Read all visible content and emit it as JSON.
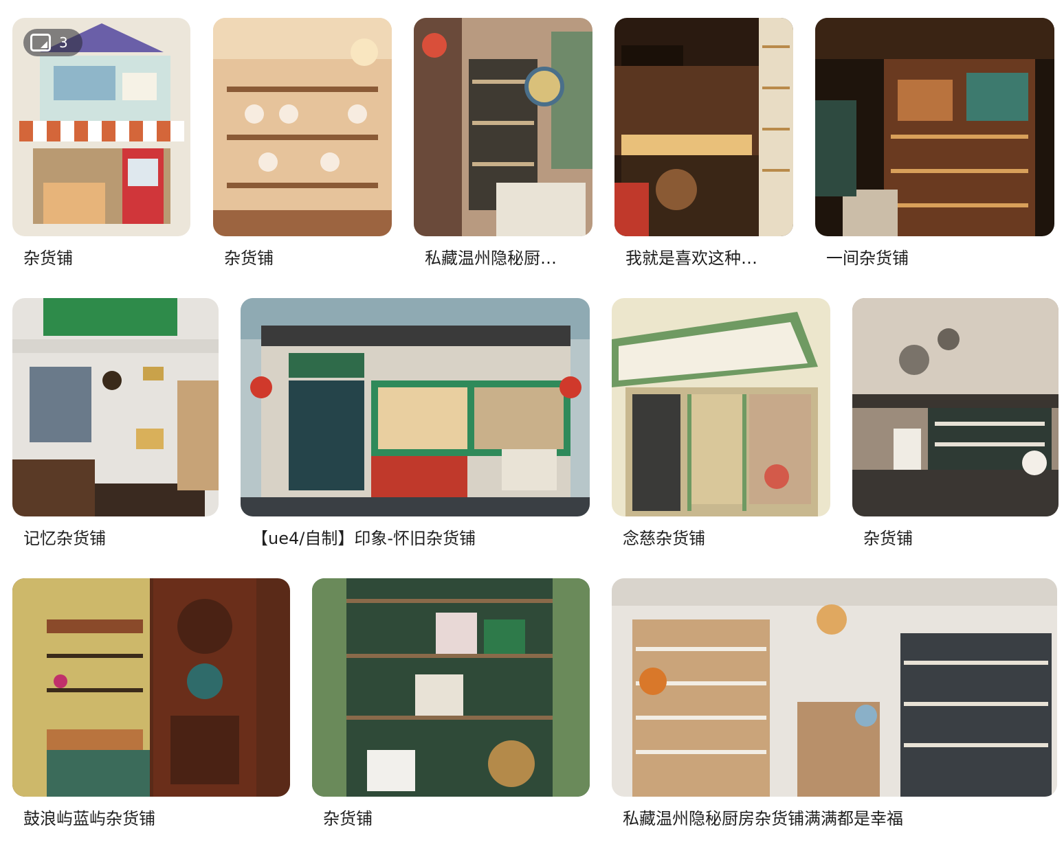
{
  "gallery": {
    "rows": [
      {
        "items": [
          {
            "caption": "杂货铺",
            "badge_count": "3",
            "palette": [
              "#e9e2d6",
              "#c86a3a",
              "#d9e8e6"
            ]
          },
          {
            "caption": "杂货铺",
            "palette": [
              "#e8c9a3",
              "#a9724a",
              "#f3e2c6"
            ]
          },
          {
            "caption": "私藏温州隐秘厨…",
            "palette": [
              "#c9a386",
              "#3f3a2f",
              "#d94f3a"
            ]
          },
          {
            "caption": "我就是喜欢这种…",
            "palette": [
              "#2c1a0f",
              "#c88a3c",
              "#f4d9a0"
            ]
          },
          {
            "caption": "一间杂货铺",
            "palette": [
              "#2a1c12",
              "#8c4f2a",
              "#3d7a6e"
            ]
          }
        ]
      },
      {
        "items": [
          {
            "caption": "记忆杂货铺",
            "palette": [
              "#e9e6e0",
              "#5a3a26",
              "#2e8b4a"
            ]
          },
          {
            "caption": "【ue4/自制】印象-怀旧杂货铺",
            "palette": [
              "#dfe6ea",
              "#3b7a5a",
              "#c63a2a"
            ]
          },
          {
            "caption": "念慈杂货铺",
            "palette": [
              "#f0e9d2",
              "#6f9a62",
              "#d35a4a"
            ]
          },
          {
            "caption": "杂货铺",
            "palette": [
              "#b8a89a",
              "#3a3530",
              "#e7e1d6"
            ]
          }
        ]
      },
      {
        "items": [
          {
            "caption": "鼓浪屿蓝屿杂货铺",
            "palette": [
              "#5a2a18",
              "#d9c05a",
              "#3b6b5a"
            ]
          },
          {
            "caption": "杂货铺",
            "palette": [
              "#2f4a38",
              "#e8e2d6",
              "#6a8a5a"
            ]
          },
          {
            "caption": "私藏温州隐秘厨房杂货铺满满都是幸福",
            "palette": [
              "#e8e4de",
              "#c98a4a",
              "#3a4a5a"
            ]
          }
        ]
      }
    ]
  }
}
